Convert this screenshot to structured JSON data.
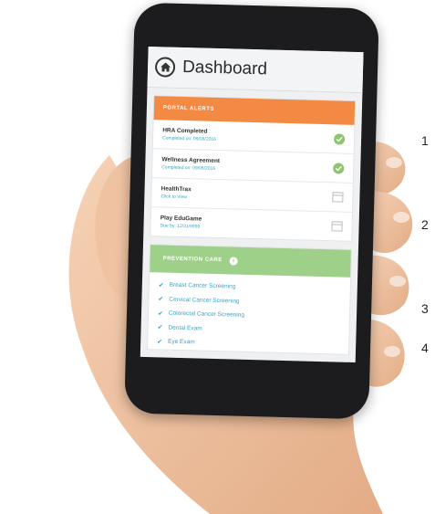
{
  "screen": {
    "title": "Dashboard",
    "portal_alerts": {
      "heading": "PORTAL ALERTS",
      "items": [
        {
          "title": "HRA Completed",
          "subtitle": "Completed on: 09/08/2016",
          "icon": "check-circle-icon"
        },
        {
          "title": "Wellness Agreement",
          "subtitle": "Completed on: 09/06/2016",
          "icon": "check-circle-icon"
        },
        {
          "title": "HealthTrax",
          "subtitle": "Click to View",
          "icon": "calendar-icon"
        },
        {
          "title": "Play EduGame",
          "subtitle": "Due by: 12/31/9999",
          "icon": "calendar-icon"
        }
      ]
    },
    "prevention_care": {
      "heading": "PREVENTION CARE",
      "items": [
        "Breast Cancer Screening",
        "Cervical Cancer Screening",
        "Colorectal Cancer Screening",
        "Dental Exam",
        "Eye Exam"
      ]
    }
  },
  "callouts": [
    "1",
    "2",
    "3",
    "4"
  ],
  "colors": {
    "alerts_header": "#f28a43",
    "prevention_header": "#9fd08a",
    "link": "#3aa3c8",
    "check": "#8cc56b"
  }
}
